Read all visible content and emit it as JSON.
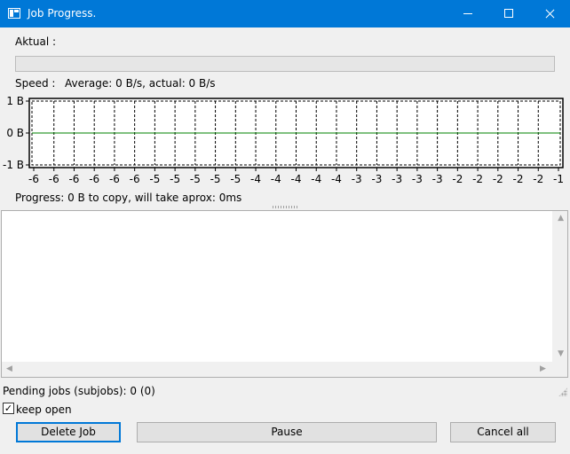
{
  "window": {
    "title": "Job Progress."
  },
  "actual": {
    "label": "Aktual :",
    "progress": 0
  },
  "speed": {
    "label": "Speed :",
    "text": "Average: 0 B/s, actual: 0 B/s"
  },
  "graph": {
    "y_ticks": [
      "1 B",
      "0 B",
      "-1 B"
    ],
    "x_ticks": [
      "-6",
      "-6",
      "-6",
      "-6",
      "-6",
      "-6",
      "-5",
      "-5",
      "-5",
      "-5",
      "-5",
      "-4",
      "-4",
      "-4",
      "-4",
      "-4",
      "-3",
      "-3",
      "-3",
      "-3",
      "-3",
      "-2",
      "-2",
      "-2",
      "-2",
      "-2",
      "-1"
    ],
    "line_color": "#008000",
    "grid_style": "dashed"
  },
  "progress_text": "Progress: 0 B to copy, will take aprox: 0ms",
  "log": {
    "lines": []
  },
  "status": {
    "pending": "Pending jobs (subjobs): 0 (0)"
  },
  "keep_open": {
    "label": "keep open",
    "checked": true,
    "mark": "✓"
  },
  "buttons": {
    "delete": "Delete Job",
    "pause": "Pause",
    "cancel_all": "Cancel all"
  },
  "icons": {
    "scroll_up": "▲",
    "scroll_down": "▼",
    "scroll_left": "◀",
    "scroll_right": "▶"
  }
}
